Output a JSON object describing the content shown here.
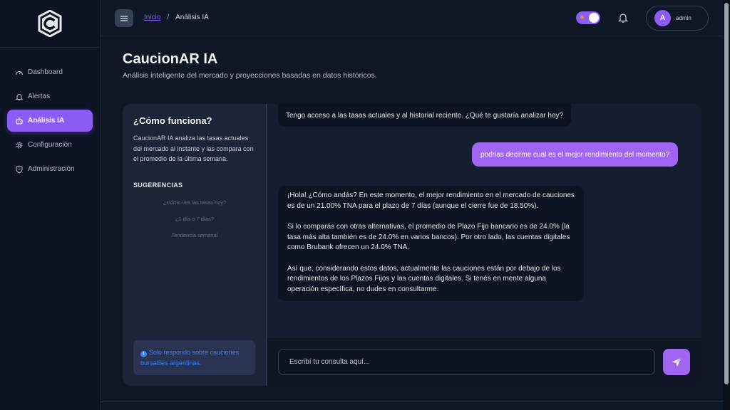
{
  "sidebar": {
    "logo_icon": "shield-c-logo",
    "items": [
      {
        "label": "Dashboard",
        "icon": "gauge-icon",
        "active": false
      },
      {
        "label": "Alertas",
        "icon": "bell-icon",
        "active": false
      },
      {
        "label": "Análisis IA",
        "icon": "robot-icon",
        "active": true
      },
      {
        "label": "Configuración",
        "icon": "gear-icon",
        "active": false
      },
      {
        "label": "Administración",
        "icon": "shield-icon",
        "active": false
      }
    ]
  },
  "topbar": {
    "breadcrumb": {
      "home": "Inicio",
      "separator": "/",
      "current": "Análisis IA"
    },
    "user": {
      "initial": "A",
      "name": "admin"
    }
  },
  "header": {
    "title": "CaucionAR IA",
    "subtitle": "Análisis inteligente del mercado y proyecciones basadas en datos históricos."
  },
  "info_panel": {
    "title": "¿Cómo funciona?",
    "description": "CaucionAR IA analiza las tasas actuales del mercado al instante y las compara con el promedio de la última semana.",
    "suggestions_title": "SUGERENCIAS",
    "suggestions": [
      "¿Cómo ves las tasas hoy?",
      "¿1 día o 7 días?",
      "Tendencia semanal"
    ],
    "note": "Solo respondo sobre cauciones bursátiles argentinas."
  },
  "chat": {
    "messages": [
      {
        "role": "bot",
        "text": "Tengo acceso a las tasas actuales y al historial reciente. ¿Qué te gustaría analizar hoy?"
      },
      {
        "role": "user",
        "text": "podrias decirme cual es el mejor rendimiento del momento?"
      },
      {
        "role": "bot",
        "paragraphs": [
          "¡Hola! ¿Cómo andás? En este momento, el mejor rendimiento en el mercado de cauciones es de un 21.00% TNA para el plazo de 7 días (aunque el cierre fue de 18.50%).",
          "Si lo comparás con otras alternativas, el promedio de Plazo Fijo bancario es de 24.0% (la tasa más alta también es de 24.0% en varios bancos). Por otro lado, las cuentas digitales como Brubank ofrecen un 24.0% TNA.",
          "Así que, considerando estos datos, actualmente las cauciones están por debajo de los rendimientos de los Plazos Fijos y las cuentas digitales. Si tenés en mente alguna operación específica, no dudes en consultarme."
        ]
      }
    ],
    "input_placeholder": "Escribí tu consulta aquí..."
  },
  "colors": {
    "accent": "#8b5cf6",
    "info": "#3b82f6",
    "background": "#0f1625"
  }
}
